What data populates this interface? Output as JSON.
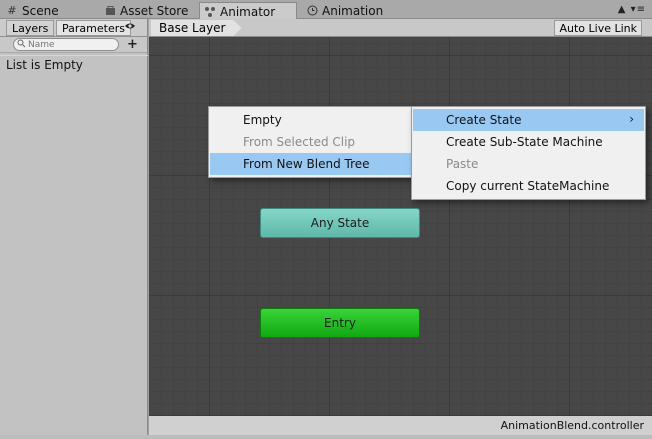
{
  "tabs": [
    {
      "label": "Scene",
      "icon": "grid-icon"
    },
    {
      "label": "Asset Store",
      "icon": "shopping-bag-icon"
    },
    {
      "label": "Animator",
      "icon": "animator-icon"
    },
    {
      "label": "Animation",
      "icon": "clock-icon"
    }
  ],
  "window_controls": "▲ ▾≡",
  "left_panel": {
    "tabs": [
      "Layers",
      "Parameters"
    ],
    "search_placeholder": "Name",
    "add_label": "+",
    "empty_text": "List is Empty"
  },
  "canvas": {
    "breadcrumb": "Base Layer",
    "auto_live_link": "Auto Live Link",
    "footer_file": "AnimationBlend.controller"
  },
  "nodes": {
    "any_state": "Any State",
    "entry": "Entry"
  },
  "menu_left": [
    {
      "label": "Empty",
      "disabled": false
    },
    {
      "label": "From Selected Clip",
      "disabled": true
    },
    {
      "label": "From New Blend Tree",
      "highlighted": true
    }
  ],
  "menu_right": [
    {
      "label": "Create State",
      "highlighted": true,
      "submenu_arrow": "›"
    },
    {
      "label": "Create Sub-State Machine"
    },
    {
      "label": "Paste",
      "disabled": true
    },
    {
      "label": "Copy current StateMachine"
    }
  ],
  "colors": {
    "canvas_bg": "#474747",
    "any_state": "#6fc6b8",
    "entry": "#22be22",
    "menu_highlight": "#99c9f3"
  }
}
